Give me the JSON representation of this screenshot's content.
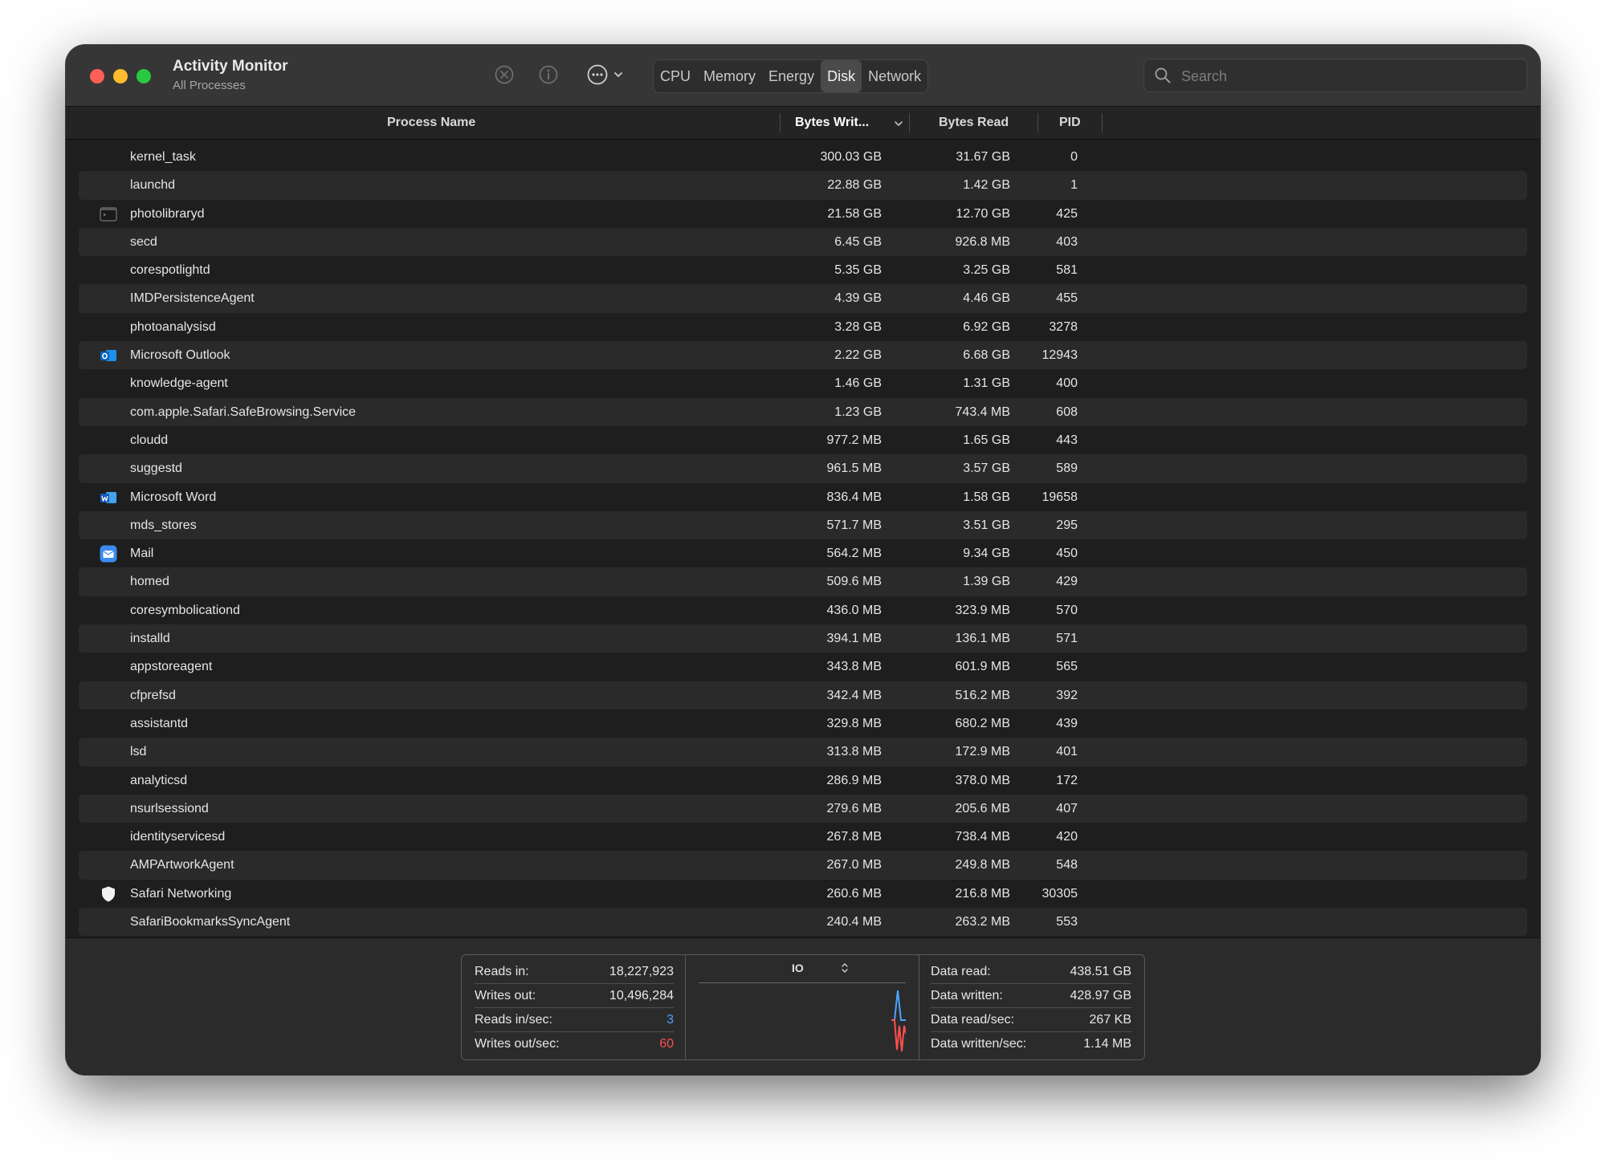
{
  "window": {
    "title": "Activity Monitor",
    "subtitle": "All Processes"
  },
  "toolbar": {
    "tabs": [
      {
        "label": "CPU",
        "active": false
      },
      {
        "label": "Memory",
        "active": false
      },
      {
        "label": "Energy",
        "active": false
      },
      {
        "label": "Disk",
        "active": true
      },
      {
        "label": "Network",
        "active": false
      }
    ],
    "icons": [
      "stop-process-icon",
      "info-icon",
      "more-actions-icon",
      "chevron-down-icon"
    ],
    "search": {
      "placeholder": "Search",
      "value": ""
    }
  },
  "columns": {
    "name": "Process Name",
    "bytes_written": "Bytes Writ...",
    "bytes_read": "Bytes Read",
    "pid": "PID"
  },
  "processes": [
    {
      "name": "kernel_task",
      "bytes_written": "300.03 GB",
      "bytes_read": "31.67 GB",
      "pid": "0",
      "icon": ""
    },
    {
      "name": "launchd",
      "bytes_written": "22.88 GB",
      "bytes_read": "1.42 GB",
      "pid": "1",
      "icon": ""
    },
    {
      "name": "photolibraryd",
      "bytes_written": "21.58 GB",
      "bytes_read": "12.70 GB",
      "pid": "425",
      "icon": "terminal-icon"
    },
    {
      "name": "secd",
      "bytes_written": "6.45 GB",
      "bytes_read": "926.8 MB",
      "pid": "403",
      "icon": ""
    },
    {
      "name": "corespotlightd",
      "bytes_written": "5.35 GB",
      "bytes_read": "3.25 GB",
      "pid": "581",
      "icon": ""
    },
    {
      "name": "IMDPersistenceAgent",
      "bytes_written": "4.39 GB",
      "bytes_read": "4.46 GB",
      "pid": "455",
      "icon": ""
    },
    {
      "name": "photoanalysisd",
      "bytes_written": "3.28 GB",
      "bytes_read": "6.92 GB",
      "pid": "3278",
      "icon": ""
    },
    {
      "name": "Microsoft Outlook",
      "bytes_written": "2.22 GB",
      "bytes_read": "6.68 GB",
      "pid": "12943",
      "icon": "outlook-icon"
    },
    {
      "name": "knowledge-agent",
      "bytes_written": "1.46 GB",
      "bytes_read": "1.31 GB",
      "pid": "400",
      "icon": ""
    },
    {
      "name": "com.apple.Safari.SafeBrowsing.Service",
      "bytes_written": "1.23 GB",
      "bytes_read": "743.4 MB",
      "pid": "608",
      "icon": ""
    },
    {
      "name": "cloudd",
      "bytes_written": "977.2 MB",
      "bytes_read": "1.65 GB",
      "pid": "443",
      "icon": ""
    },
    {
      "name": "suggestd",
      "bytes_written": "961.5 MB",
      "bytes_read": "3.57 GB",
      "pid": "589",
      "icon": ""
    },
    {
      "name": "Microsoft Word",
      "bytes_written": "836.4 MB",
      "bytes_read": "1.58 GB",
      "pid": "19658",
      "icon": "word-icon"
    },
    {
      "name": "mds_stores",
      "bytes_written": "571.7 MB",
      "bytes_read": "3.51 GB",
      "pid": "295",
      "icon": ""
    },
    {
      "name": "Mail",
      "bytes_written": "564.2 MB",
      "bytes_read": "9.34 GB",
      "pid": "450",
      "icon": "mail-icon"
    },
    {
      "name": "homed",
      "bytes_written": "509.6 MB",
      "bytes_read": "1.39 GB",
      "pid": "429",
      "icon": ""
    },
    {
      "name": "coresymbolicationd",
      "bytes_written": "436.0 MB",
      "bytes_read": "323.9 MB",
      "pid": "570",
      "icon": ""
    },
    {
      "name": "installd",
      "bytes_written": "394.1 MB",
      "bytes_read": "136.1 MB",
      "pid": "571",
      "icon": ""
    },
    {
      "name": "appstoreagent",
      "bytes_written": "343.8 MB",
      "bytes_read": "601.9 MB",
      "pid": "565",
      "icon": ""
    },
    {
      "name": "cfprefsd",
      "bytes_written": "342.4 MB",
      "bytes_read": "516.2 MB",
      "pid": "392",
      "icon": ""
    },
    {
      "name": "assistantd",
      "bytes_written": "329.8 MB",
      "bytes_read": "680.2 MB",
      "pid": "439",
      "icon": ""
    },
    {
      "name": "lsd",
      "bytes_written": "313.8 MB",
      "bytes_read": "172.9 MB",
      "pid": "401",
      "icon": ""
    },
    {
      "name": "analyticsd",
      "bytes_written": "286.9 MB",
      "bytes_read": "378.0 MB",
      "pid": "172",
      "icon": ""
    },
    {
      "name": "nsurlsessiond",
      "bytes_written": "279.6 MB",
      "bytes_read": "205.6 MB",
      "pid": "407",
      "icon": ""
    },
    {
      "name": "identityservicesd",
      "bytes_written": "267.8 MB",
      "bytes_read": "738.4 MB",
      "pid": "420",
      "icon": ""
    },
    {
      "name": "AMPArtworkAgent",
      "bytes_written": "267.0 MB",
      "bytes_read": "249.8 MB",
      "pid": "548",
      "icon": ""
    },
    {
      "name": "Safari Networking",
      "bytes_written": "260.6 MB",
      "bytes_read": "216.8 MB",
      "pid": "30305",
      "icon": "shield-icon"
    },
    {
      "name": "SafariBookmarksSyncAgent",
      "bytes_written": "240.4 MB",
      "bytes_read": "263.2 MB",
      "pid": "553",
      "icon": ""
    }
  ],
  "summary": {
    "left": [
      {
        "label": "Reads in:",
        "value": "18,227,923",
        "color": ""
      },
      {
        "label": "Writes out:",
        "value": "10,496,284",
        "color": ""
      },
      {
        "label": "Reads in/sec:",
        "value": "3",
        "color": "#4aa3ff"
      },
      {
        "label": "Writes out/sec:",
        "value": "60",
        "color": "#ff4d4d"
      }
    ],
    "graph_label": "IO",
    "right": [
      {
        "label": "Data read:",
        "value": "438.51 GB"
      },
      {
        "label": "Data written:",
        "value": "428.97 GB"
      },
      {
        "label": "Data read/sec:",
        "value": "267 KB"
      },
      {
        "label": "Data written/sec:",
        "value": "1.14 MB"
      }
    ],
    "graph_colors": {
      "reads": "#4aa3ff",
      "writes": "#ff4d4d"
    }
  }
}
